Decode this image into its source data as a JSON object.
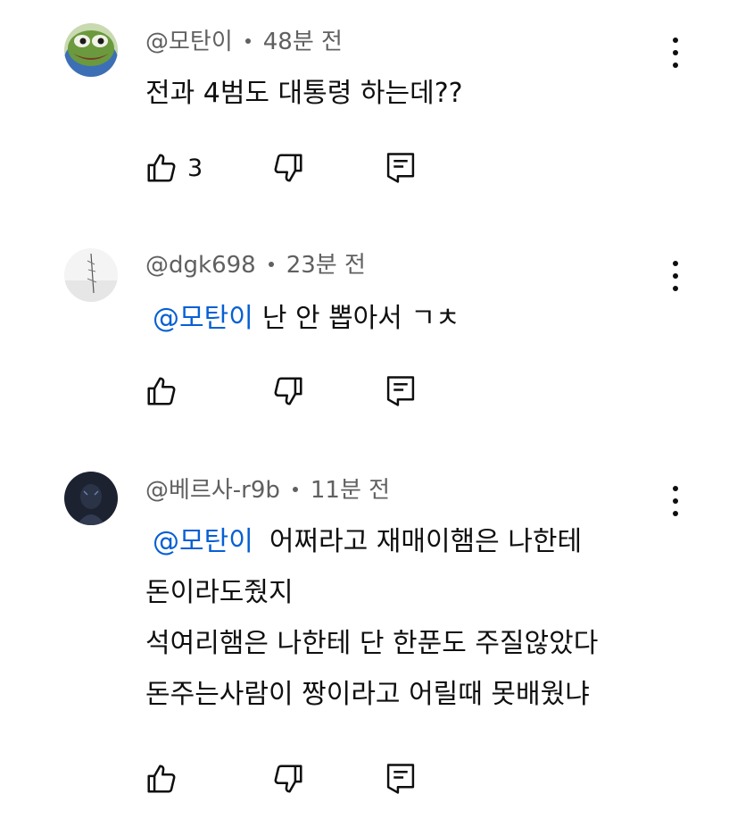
{
  "comments": [
    {
      "author": "@모탄이",
      "time": "48분 전",
      "lines": [
        "전과 4범도 대통령 하는데??"
      ],
      "mention": "",
      "likes": "3"
    },
    {
      "author": "@dgk698",
      "time": "23분 전",
      "mention": "@모탄이",
      "lines": [
        "난 안 뽑아서 ㄱㅊ"
      ],
      "likes": ""
    },
    {
      "author": "@베르사-r9b",
      "time": "11분 전",
      "mention": "@모탄이",
      "lines": [
        "어쩌라고 재매이햄은 나한테",
        "돈이라도줬지",
        "석여리햄은 나한테 단 한푼도 주질않았다",
        "돈주는사람이 짱이라고 어릴때 못배웠냐"
      ],
      "likes": ""
    }
  ],
  "icons": {
    "like": "thumb-up-icon",
    "dislike": "thumb-down-icon",
    "reply": "reply-icon",
    "more": "more-vert-icon"
  },
  "colors": {
    "mention": "#065fd4",
    "meta": "#606060",
    "text": "#0f0f0f"
  }
}
